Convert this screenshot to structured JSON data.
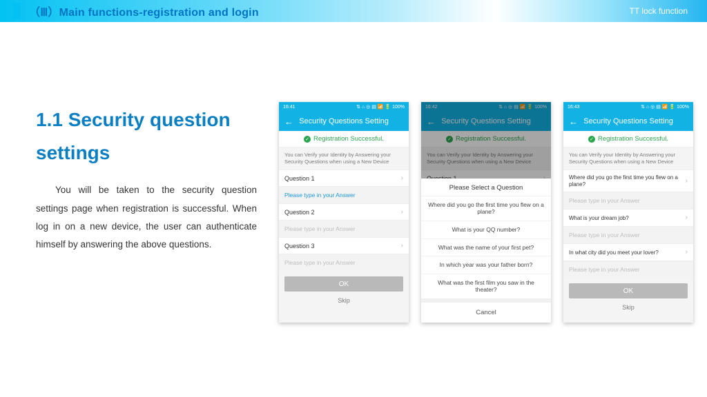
{
  "topbar": {
    "title": "（Ⅲ）Main functions-registration and login",
    "tag": "TT lock function"
  },
  "section": {
    "heading": "1.1 Security question settings",
    "body": "You will be taken to the security question settings page when registration is successful. When log in on a new device, the user can authenticate himself by answering the above questions."
  },
  "phone_common": {
    "time": "16:41",
    "status_icons": "⇅ ⌂ ◎ ▤ 📶 🔋 100%",
    "appbar_title": "Security Questions Setting",
    "back_glyph": "←",
    "banner_check": "✓",
    "banner_text": "Registration Successful.",
    "hint": "You can Verify your Identity by Answering your Security Questions when using a New Device",
    "placeholder": "Please type in your Answer",
    "ok": "OK",
    "skip": "Skip",
    "chevron": "›"
  },
  "phone1": {
    "q1": "Question 1",
    "q2": "Question 2",
    "q3": "Question 3"
  },
  "phone2": {
    "time": "16:42",
    "q1": "Question 1",
    "sheet_title": "Please Select a Question",
    "options": [
      "Where did you go the first time you flew on a plane?",
      "What is your QQ number?",
      "What was the name of your first pet?",
      "In which year was your father born?",
      "What was the first film you saw in the theater?"
    ],
    "cancel": "Cancel"
  },
  "phone3": {
    "time": "16:43",
    "q1": "Where did you go the first time you flew on a plane?",
    "q2": "What is your dream job?",
    "q3": "In what city did you meet your lover?"
  }
}
